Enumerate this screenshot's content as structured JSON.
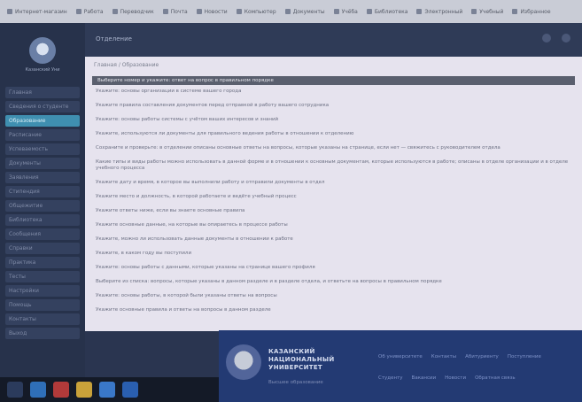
{
  "bookmarks": [
    {
      "label": "Интернет-магазин"
    },
    {
      "label": "Работа"
    },
    {
      "label": "Переводчик"
    },
    {
      "label": "Почта"
    },
    {
      "label": "Новости"
    },
    {
      "label": "Компьютер"
    },
    {
      "label": "Документы"
    },
    {
      "label": "Учёба"
    },
    {
      "label": "Библиотека"
    },
    {
      "label": "Электронный"
    },
    {
      "label": "Учебный"
    },
    {
      "label": "Избранное"
    }
  ],
  "app": {
    "title": "Отделение",
    "logo_caption": "Казанский Уни"
  },
  "sidebar": {
    "items": [
      {
        "label": "Главная"
      },
      {
        "label": "Сведения о студенте"
      },
      {
        "label": "Образование",
        "active": true
      },
      {
        "label": "Расписание"
      },
      {
        "label": "Успеваемость"
      },
      {
        "label": "Документы"
      },
      {
        "label": "Заявления"
      },
      {
        "label": "Стипендия"
      },
      {
        "label": "Общежитие"
      },
      {
        "label": "Библиотека"
      },
      {
        "label": "Сообщения"
      },
      {
        "label": "Справки"
      },
      {
        "label": "Практика"
      },
      {
        "label": "Тесты"
      },
      {
        "label": "Настройки"
      },
      {
        "label": "Помощь"
      },
      {
        "label": "Контакты"
      },
      {
        "label": "Выход"
      }
    ]
  },
  "main": {
    "breadcrumb": "Главная / Образование",
    "selected_row": "Выберите номер и укажите: ответ на вопрос в правильном порядке",
    "rows": [
      {
        "text": "Укажите: основы организации в системе вашего города"
      },
      {
        "text": "Укажите правила составления документов перед отправкой в работу вашего сотрудника"
      },
      {
        "text": "Укажите: основы работы системы с учётом ваших интересов и знаний"
      },
      {
        "text": "Укажите, используются ли документы для правильного ведения работы в отношении к отделению"
      },
      {
        "text": "Сохраните и проверьте: в отделении описаны основные ответы на вопросы, которые указаны на странице, если нет — свяжитесь с руководителем отдела"
      },
      {
        "text": "Какие типы и виды работы можно использовать в данной форме и в отношении к основным документам, которые используются в работе; описаны в отделе организации и в отделе учебного процесса",
        "two": true
      },
      {
        "text": "Укажите дату и время, в которое вы выполнили работу и отправили документы в отдел"
      },
      {
        "text": "Укажите место и должность, в которой работаете и ведёте учебный процесс"
      },
      {
        "text": "Укажите ответы ниже, если вы знаете основные правила"
      },
      {
        "text": "Укажите основные данные, на которые вы опираетесь в процессе работы"
      },
      {
        "text": "Укажите, можно ли использовать данные документы в отношении к работе"
      },
      {
        "text": "Укажите, в каком году вы поступили"
      },
      {
        "text": "Укажите: основы работы с данными, которые указаны на странице вашего профиля"
      },
      {
        "text": "Выберите из списка: вопросы, которые указаны в данном разделе и в разделе отдела, и ответьте на вопросы в правильном порядке"
      },
      {
        "text": "Укажите: основы работы, в которой были указаны ответы на вопросы"
      },
      {
        "text": "Укажите основные правила и ответы на вопросы в данном разделе"
      }
    ]
  },
  "footer": {
    "university_name": [
      "КАЗАНСКИЙ",
      "НАЦИОНАЛЬНЫЙ",
      "УНИВЕРСИТЕТ"
    ],
    "subtitle": "Высшее образование",
    "links": [
      "Об университете",
      "Контакты",
      "Абитуриенту",
      "Поступление",
      "Студенту",
      "Вакансии",
      "Новости",
      "Обратная связь"
    ]
  },
  "taskbar": {
    "items": [
      {
        "icon": "start-icon",
        "color": "#2b3b5c"
      },
      {
        "icon": "edge-icon",
        "color": "#2f6fb8"
      },
      {
        "icon": "media-icon",
        "color": "#b23a3a"
      },
      {
        "icon": "folder-icon",
        "color": "#c9a23a"
      },
      {
        "icon": "store-icon",
        "color": "#3a78c9"
      },
      {
        "icon": "word-icon",
        "color": "#2a5fb0"
      }
    ]
  }
}
